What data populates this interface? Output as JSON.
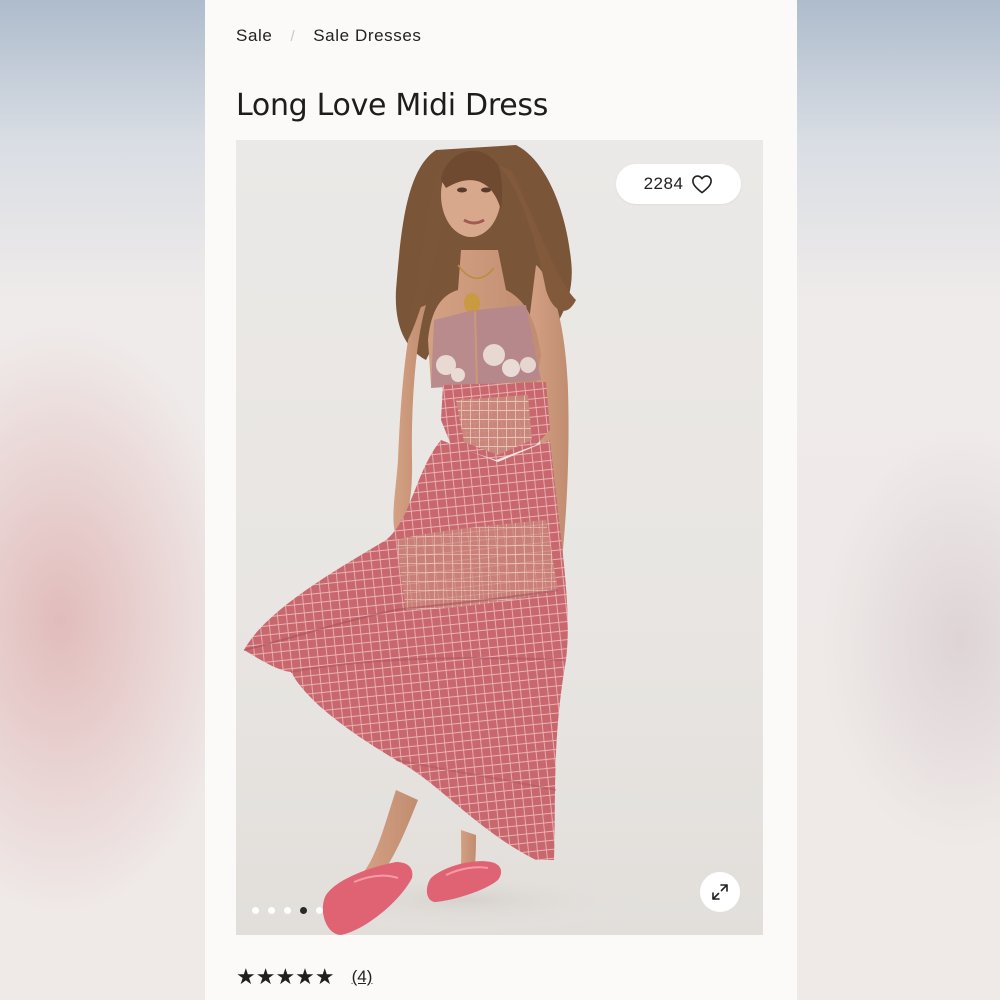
{
  "breadcrumb": {
    "items": [
      "Sale",
      "Sale Dresses"
    ],
    "separator": "/"
  },
  "product": {
    "title": "Long Love Midi Dress",
    "favorites_count": "2284",
    "rating": {
      "stars": "★★★★★",
      "value": 5,
      "review_count": "(4)"
    }
  },
  "gallery": {
    "image_count": 5,
    "active_index": 3,
    "expand_icon": "expand-arrows-icon",
    "favorite_icon": "heart-outline-icon"
  },
  "colors": {
    "dress": "#c8686e",
    "shoes": "#e06373",
    "background": "#e9e6e3"
  }
}
